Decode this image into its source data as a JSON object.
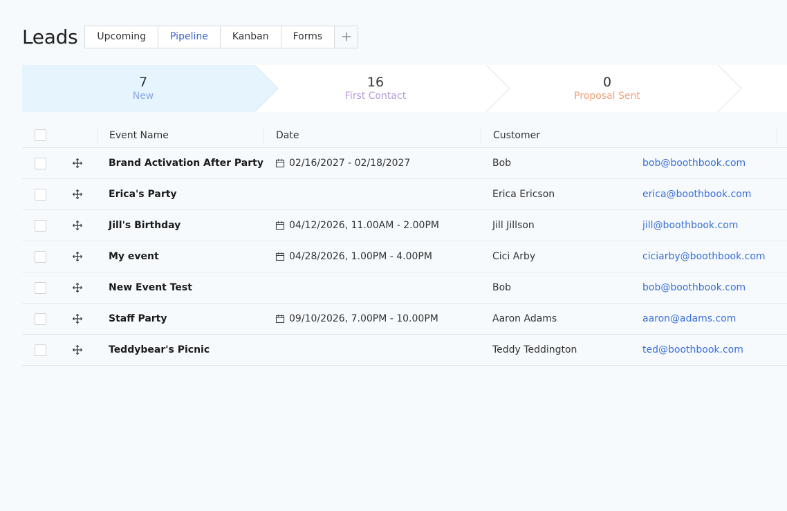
{
  "header": {
    "title": "Leads",
    "tabs": [
      {
        "label": "Upcoming",
        "active": false
      },
      {
        "label": "Pipeline",
        "active": true
      },
      {
        "label": "Kanban",
        "active": false
      },
      {
        "label": "Forms",
        "active": false
      }
    ],
    "add_tab_icon": "plus-icon"
  },
  "pipeline": {
    "stages": [
      {
        "count": "7",
        "label": "New",
        "color": "#8aa7e0",
        "active": true
      },
      {
        "count": "16",
        "label": "First Contact",
        "color": "#b79ad9",
        "active": false
      },
      {
        "count": "0",
        "label": "Proposal Sent",
        "color": "#f2a07a",
        "active": false
      }
    ]
  },
  "table": {
    "columns": [
      "Event Name",
      "Date",
      "Customer"
    ],
    "rows": [
      {
        "name": "Brand Activation After Party",
        "date": "02/16/2027 - 02/18/2027",
        "customer": "Bob",
        "email": "bob@boothbook.com"
      },
      {
        "name": "Erica's Party",
        "date": "",
        "customer": "Erica Ericson",
        "email": "erica@boothbook.com"
      },
      {
        "name": "Jill's Birthday",
        "date": "04/12/2026, 11.00AM - 2.00PM",
        "customer": "Jill Jillson",
        "email": "jill@boothbook.com"
      },
      {
        "name": "My event",
        "date": "04/28/2026, 1.00PM - 4.00PM",
        "customer": "Cici Arby",
        "email": "ciciarby@boothbook.com"
      },
      {
        "name": "New Event Test",
        "date": "",
        "customer": "Bob",
        "email": "bob@boothbook.com"
      },
      {
        "name": "Staff Party",
        "date": "09/10/2026, 7.00PM - 10.00PM",
        "customer": "Aaron Adams",
        "email": "aaron@adams.com"
      },
      {
        "name": "Teddybear's Picnic",
        "date": "",
        "customer": "Teddy Teddington",
        "email": "ted@boothbook.com"
      }
    ]
  },
  "colors": {
    "accent": "#3b63c9",
    "link": "#3a6fd8",
    "active_stage_bg": "#e5f4fd",
    "page_bg": "#f6fafd"
  }
}
